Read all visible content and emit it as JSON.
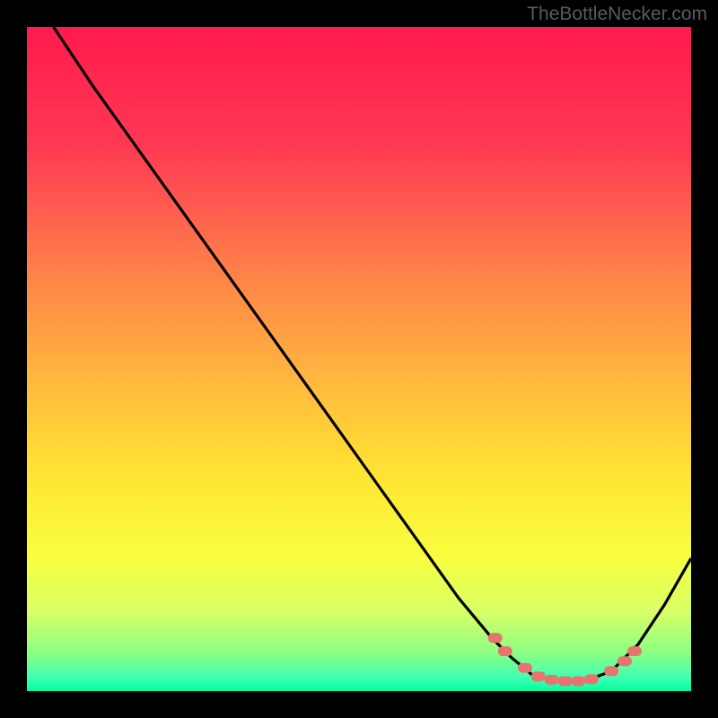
{
  "watermark": "TheBottleNecker.com",
  "chart_data": {
    "type": "line",
    "title": "",
    "xlabel": "",
    "ylabel": "",
    "xlim": [
      0,
      100
    ],
    "ylim": [
      0,
      100
    ],
    "curve_points": [
      [
        4,
        0
      ],
      [
        10,
        9
      ],
      [
        20,
        23
      ],
      [
        30,
        37
      ],
      [
        40,
        51
      ],
      [
        50,
        65
      ],
      [
        60,
        79
      ],
      [
        65,
        86
      ],
      [
        70,
        92
      ],
      [
        73,
        95
      ],
      [
        76,
        97.5
      ],
      [
        80,
        98.5
      ],
      [
        84,
        98.5
      ],
      [
        88,
        97
      ],
      [
        92,
        93
      ],
      [
        96,
        87
      ],
      [
        100,
        80
      ]
    ],
    "marker_points": [
      [
        70.5,
        92
      ],
      [
        72,
        94
      ],
      [
        75,
        96.5
      ],
      [
        77,
        97.8
      ],
      [
        79,
        98.3
      ],
      [
        81,
        98.5
      ],
      [
        83,
        98.5
      ],
      [
        85,
        98.2
      ],
      [
        88,
        97
      ],
      [
        90,
        95.5
      ],
      [
        91.5,
        94
      ]
    ],
    "gradient_stops": [
      {
        "offset": 0,
        "color": "#ff1a4d"
      },
      {
        "offset": 18,
        "color": "#ff3954"
      },
      {
        "offset": 35,
        "color": "#ff7a4a"
      },
      {
        "offset": 52,
        "color": "#ffb43f"
      },
      {
        "offset": 68,
        "color": "#ffe633"
      },
      {
        "offset": 80,
        "color": "#f8ff3f"
      },
      {
        "offset": 88,
        "color": "#d9ff66"
      },
      {
        "offset": 94,
        "color": "#8fff80"
      },
      {
        "offset": 98,
        "color": "#3fffb3"
      },
      {
        "offset": 100,
        "color": "#00ff9f"
      }
    ],
    "marker_color": "#e8746f",
    "curve_color": "#000000"
  }
}
